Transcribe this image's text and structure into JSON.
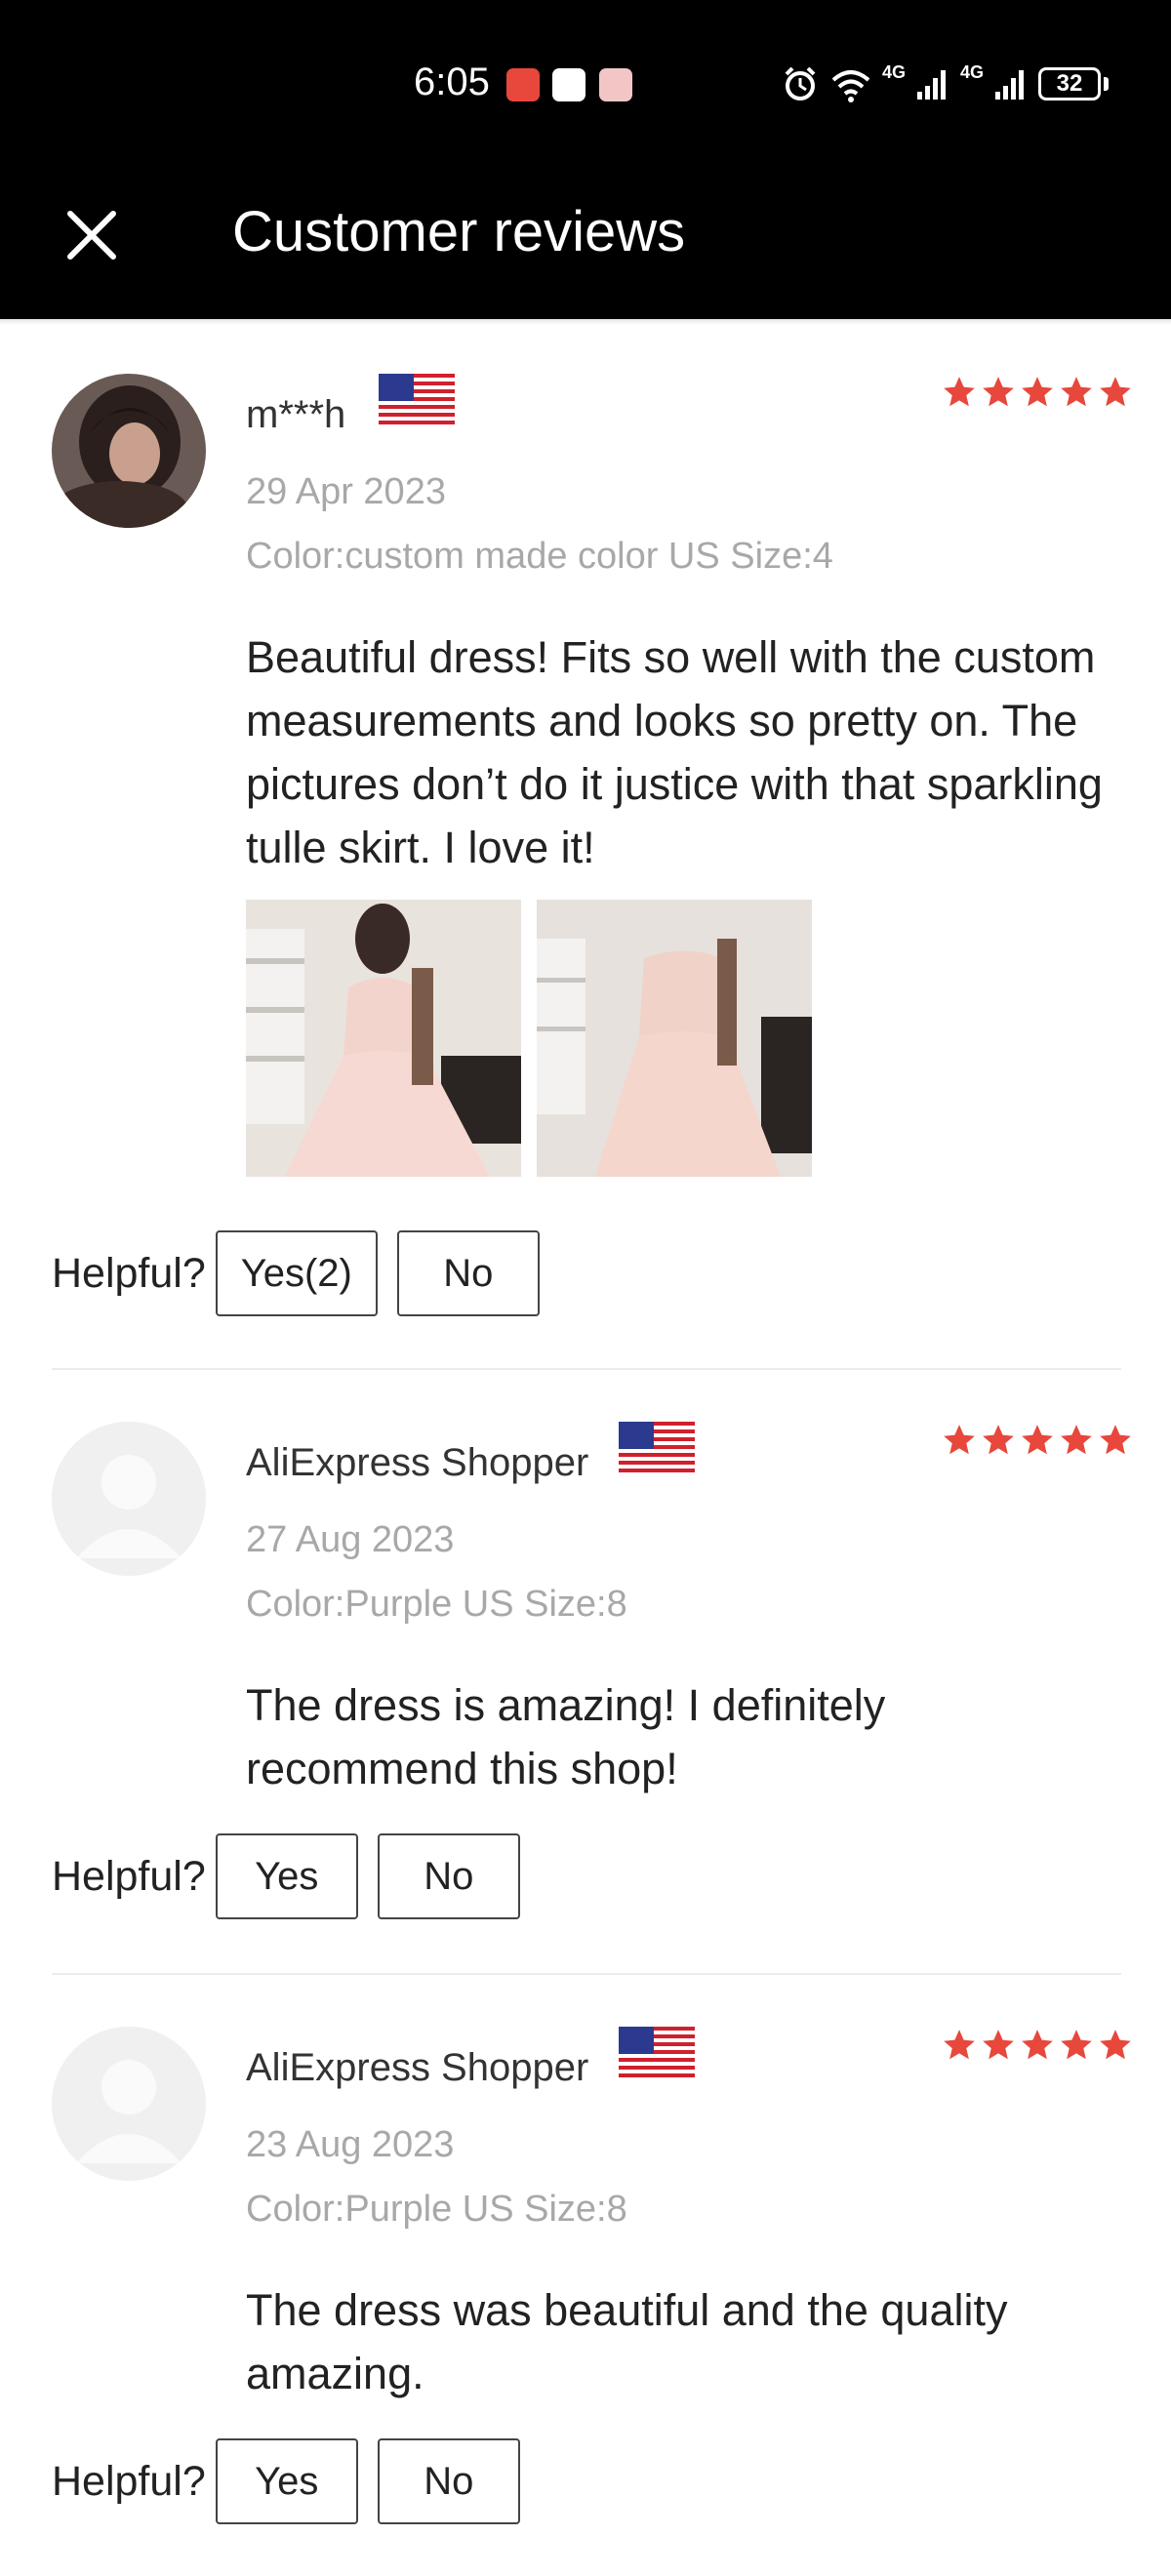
{
  "status_bar": {
    "time": "6:05",
    "battery": "32",
    "network_1": "4G",
    "network_2": "4G",
    "wifi_badge": "6"
  },
  "header": {
    "title": "Customer reviews",
    "close_icon": "close-icon"
  },
  "helpful_label": "Helpful?",
  "reviews": [
    {
      "name": "m***h",
      "country_flag": "us-flag-icon",
      "rating": 5,
      "date": "29 Apr 2023",
      "variant": "Color:custom made color US Size:4",
      "text": "Beautiful dress! Fits so well with the custom measurements and looks so pretty on. The pictures don’t do it justice with that sparkling tulle skirt. I love it!",
      "photos": [
        "review-photo-1",
        "review-photo-2"
      ],
      "yes_label": "Yes(2)",
      "no_label": "No"
    },
    {
      "name": "AliExpress Shopper",
      "country_flag": "us-flag-icon",
      "rating": 5,
      "date": "27 Aug 2023",
      "variant": "Color:Purple US Size:8",
      "text": "The dress is amazing! I definitely recommend this shop!",
      "yes_label": "Yes",
      "no_label": "No"
    },
    {
      "name": "AliExpress Shopper",
      "country_flag": "us-flag-icon",
      "rating": 5,
      "date": "23 Aug 2023",
      "variant": "Color:Purple US Size:8",
      "text": "The dress was beautiful and the quality amazing.",
      "yes_label": "Yes",
      "no_label": "No"
    }
  ],
  "colors": {
    "star": "#e8473c",
    "header_bg": "#000000",
    "meta_text": "#a8a8a8"
  }
}
